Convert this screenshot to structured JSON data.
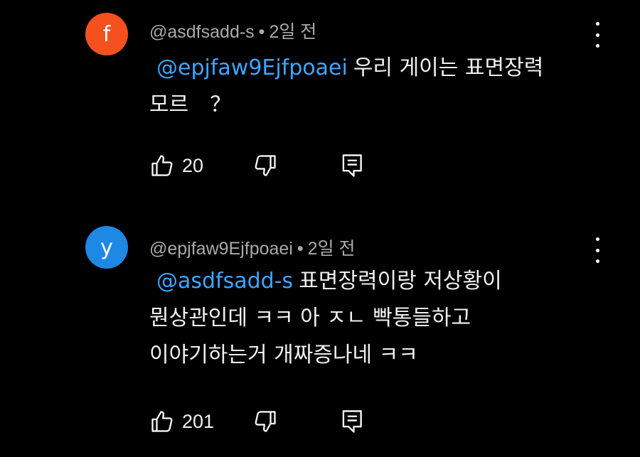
{
  "comments": [
    {
      "avatar_letter": "f",
      "avatar_color": "#f4511e",
      "author": "@asdfsadd-s",
      "separator": "•",
      "time": "2일 전",
      "mention": "@epjfaw9Ejfpoaei",
      "lines": [
        "우리 게이는 표면장력",
        "모르　？"
      ],
      "like_count": "20"
    },
    {
      "avatar_letter": "y",
      "avatar_color": "#1e88e5",
      "author": "@epjfaw9Ejfpoaei",
      "separator": "•",
      "time": "2일 전",
      "mention": "@asdfsadd-s",
      "lines": [
        "표면장력이랑 저상황이",
        "뭔상관인데 ㅋㅋ 아 ㅈㄴ 빡통들하고",
        "이야기하는거 개짜증나네 ㅋㅋ"
      ],
      "like_count": "201"
    }
  ],
  "icons": {
    "like": "thumbs-up-icon",
    "dislike": "thumbs-down-icon",
    "reply": "reply-icon",
    "more": "more-vert-icon"
  }
}
